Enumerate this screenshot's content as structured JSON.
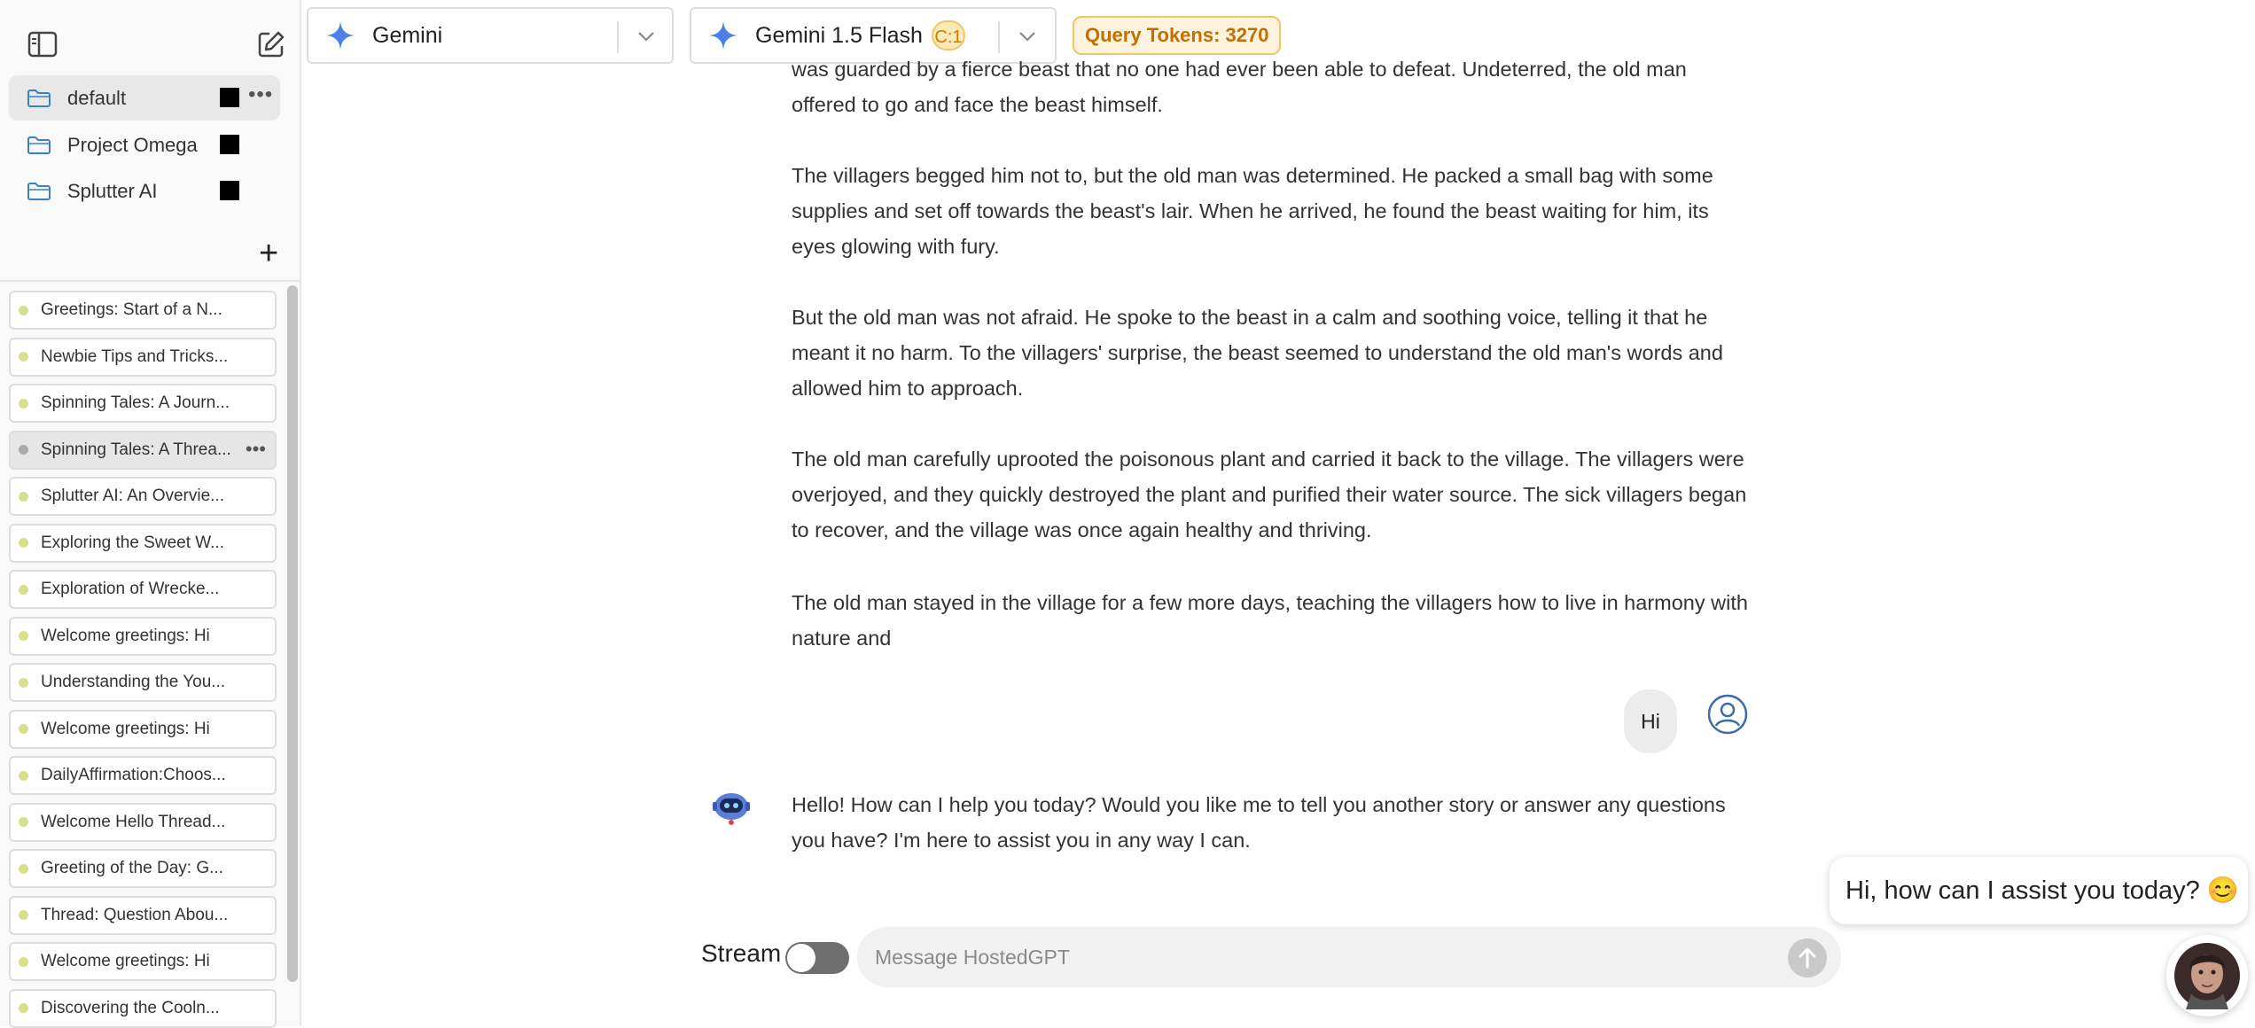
{
  "sidebar": {
    "folders": [
      {
        "label": "default",
        "color": "#000000"
      },
      {
        "label": "Project Omega",
        "color": "#000000"
      },
      {
        "label": "Splutter AI",
        "color": "#000000"
      }
    ],
    "threads": [
      {
        "label": "Greetings: Start of a N..."
      },
      {
        "label": "Newbie Tips and Tricks..."
      },
      {
        "label": "Spinning Tales: A Journ..."
      },
      {
        "label": "Spinning Tales: A Threa..."
      },
      {
        "label": "Splutter AI: An Overvie..."
      },
      {
        "label": "Exploring the Sweet W..."
      },
      {
        "label": "Exploration of Wrecke..."
      },
      {
        "label": "Welcome greetings: Hi"
      },
      {
        "label": "Understanding the You..."
      },
      {
        "label": "Welcome greetings: Hi"
      },
      {
        "label": "DailyAffirmation:Choos..."
      },
      {
        "label": "Welcome Hello Thread..."
      },
      {
        "label": "Greeting of the Day: G..."
      },
      {
        "label": "Thread: Question Abou..."
      },
      {
        "label": "Welcome greetings: Hi"
      },
      {
        "label": "Discovering the Cooln..."
      }
    ],
    "dot_color": "#d8df8c"
  },
  "header": {
    "provider": "Gemini",
    "model": "Gemini 1.5 Flash",
    "model_badge": "C:1",
    "query_tokens": "Query Tokens: 3270"
  },
  "messages": {
    "story_paragraphs": [
      "was guarded by a fierce beast that no one had ever been able to defeat. Undeterred, the old man offered to go and face the beast himself.",
      "The villagers begged him not to, but the old man was determined. He packed a small bag with some supplies and set off towards the beast's lair. When he arrived, he found the beast waiting for him, its eyes glowing with fury.",
      "But the old man was not afraid. He spoke to the beast in a calm and soothing voice, telling it that he meant it no harm. To the villagers' surprise, the beast seemed to understand the old man's words and allowed him to approach.",
      "The old man carefully uprooted the poisonous plant and carried it back to the village. The villagers were overjoyed, and they quickly destroyed the plant and purified their water source. The sick villagers began to recover, and the village was once again healthy and thriving.",
      "The old man stayed in the village for a few more days, teaching the villagers how to live in harmony with nature and"
    ],
    "user_message": "Hi",
    "assistant_reply": "Hello! How can I help you today? Would you like me to tell you another story or answer any questions you have? I'm here to assist you in any way I can."
  },
  "composer": {
    "stream_label": "Stream",
    "stream_on": false,
    "placeholder": "Message HostedGPT"
  },
  "widget": {
    "greeting": "Hi, how can I assist you today? 😊"
  },
  "colors": {
    "accent_orange": "#c06f00",
    "gemini_blue": "#4a80e8"
  }
}
